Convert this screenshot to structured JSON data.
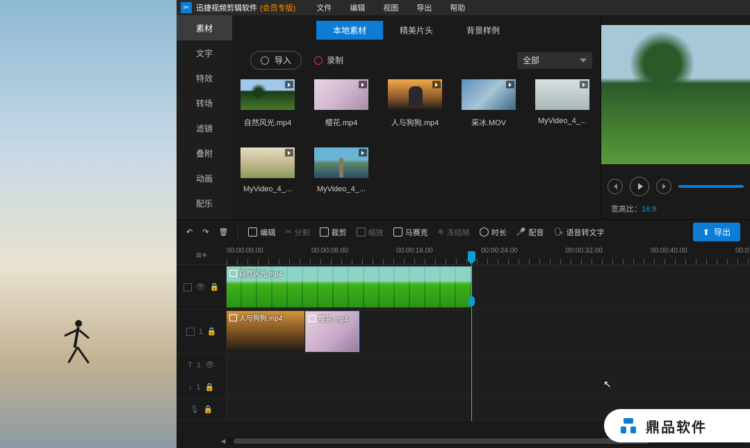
{
  "titlebar": {
    "name": "迅捷视频剪辑软件",
    "edition": "(会员专版)"
  },
  "menu": [
    "文件",
    "编辑",
    "视图",
    "导出",
    "帮助"
  ],
  "sideTabs": [
    "素材",
    "文字",
    "特效",
    "转场",
    "滤镜",
    "叠附",
    "动画",
    "配乐"
  ],
  "subTabs": [
    "本地素材",
    "精美片头",
    "背景样例"
  ],
  "importBtn": "导入",
  "recordBtn": "录制",
  "dropdown": "全部",
  "thumbs": [
    {
      "label": "自然风光.mp4",
      "cls": "th-nature"
    },
    {
      "label": "樱花.mp4",
      "cls": "th-sakura"
    },
    {
      "label": "人与狗狗.mp4",
      "cls": "th-dog"
    },
    {
      "label": "采冰.MOV",
      "cls": "th-ice"
    },
    {
      "label": "MyVideo_4_...",
      "cls": "th-vid4"
    },
    {
      "label": "MyVideo_4_...",
      "cls": "th-vid5"
    },
    {
      "label": "MyVideo_4_...",
      "cls": "th-vid6"
    }
  ],
  "ratioLabel": "宽高比：",
  "ratioValue": "16:9",
  "toolbar": {
    "edit": "编辑",
    "split": "分割",
    "crop": "裁剪",
    "zoom": "缩放",
    "mosaic": "马赛克",
    "freeze": "冻结帧",
    "duration": "时长",
    "dub": "配音",
    "stt": "语音转文字",
    "export": "导出"
  },
  "timestamps": [
    "00:00:00.00",
    "00:00:08.00",
    "00:00:16.00",
    "00:00:24.00",
    "00:00:32.00",
    "00:00:40.00",
    "00:0"
  ],
  "clips": {
    "nature": "自然风光.mp4",
    "dog": "人与狗狗.mp4",
    "sakura": "樱花.mp4"
  },
  "watermark": "鼎品软件"
}
